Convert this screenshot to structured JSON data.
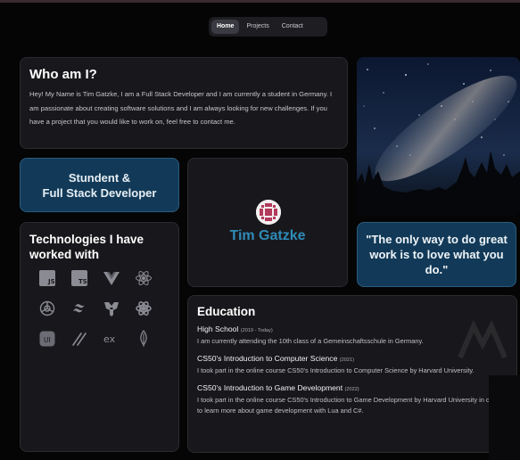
{
  "nav": {
    "items": [
      {
        "label": "Home",
        "active": true
      },
      {
        "label": "Projects",
        "active": false
      },
      {
        "label": "Contact",
        "active": false
      }
    ]
  },
  "about": {
    "title": "Who am I?",
    "text": "Hey! My Name is Tim Gatzke, I am a Full Stack Developer and I am currently a student in Germany. I am passionate about creating software solutions and I am always looking for new challenges. If you have a project that you would like to work on, feel free to contact me."
  },
  "role": {
    "line1": "Stundent &",
    "line2": "Full Stack Developer"
  },
  "profile": {
    "name": "Tim Gatzke"
  },
  "quote": {
    "text": "\"The only way to do great work is to love what you do.\""
  },
  "technologies": {
    "title": "Technologies I have worked with",
    "icons": [
      {
        "name": "javascript",
        "label": "JS"
      },
      {
        "name": "typescript",
        "label": "TS"
      },
      {
        "name": "vue"
      },
      {
        "name": "react"
      },
      {
        "name": "openai"
      },
      {
        "name": "tailwind"
      },
      {
        "name": "transformers"
      },
      {
        "name": "react-native"
      },
      {
        "name": "ui",
        "label": "UI"
      },
      {
        "name": "slash-lines"
      },
      {
        "name": "express",
        "label": "ex"
      },
      {
        "name": "mongodb"
      }
    ]
  },
  "education": {
    "title": "Education",
    "items": [
      {
        "title": "High School",
        "years": "(2019 - Today)",
        "desc": "I am currently attending the 10th class of a Gemeinschaftsschule in Germany."
      },
      {
        "title": "CS50's Introduction to Computer Science",
        "years": "(2021)",
        "desc": "I took part in the online course CS50's Introduction to Computer Science by Harvard University."
      },
      {
        "title": "CS50's Introduction to Game Development",
        "years": "(2022)",
        "desc": "I took part in the online course CS50's Introduction to Game Development by Harvard University in order to learn more about game development with Lua and C#."
      }
    ]
  },
  "colors": {
    "accent_blue": "#2f8bb8",
    "card_blue": "#123a58",
    "card_dark": "#18181c"
  }
}
